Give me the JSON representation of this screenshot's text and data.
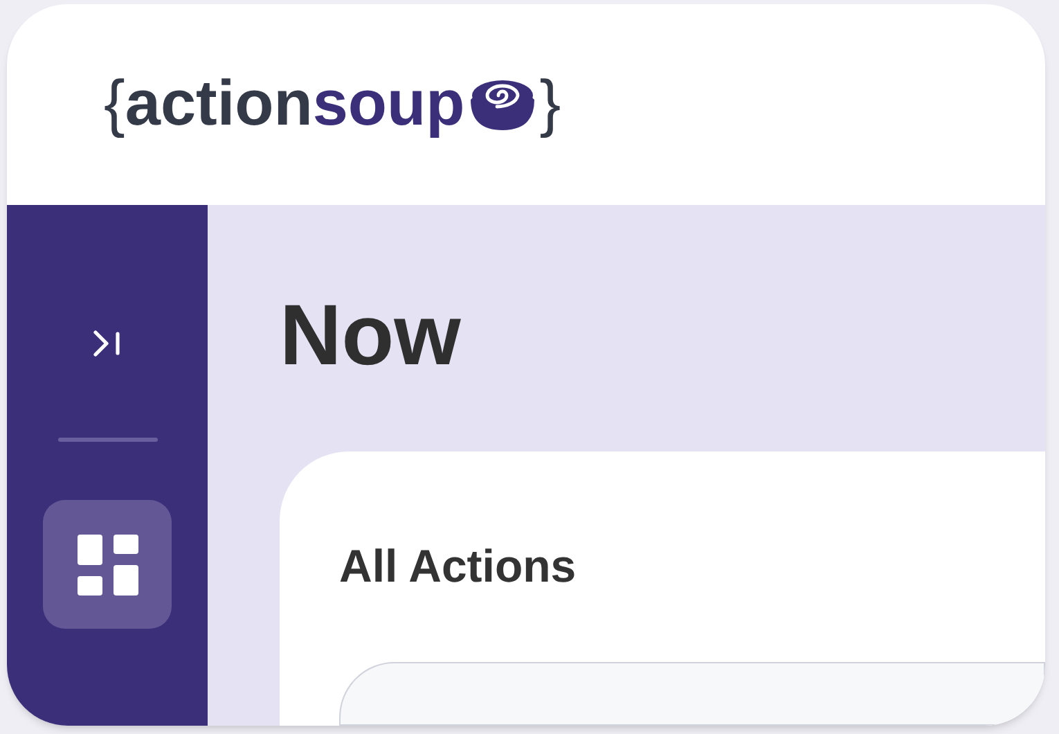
{
  "logo": {
    "open_brace": "{",
    "word_dark": "action",
    "word_accent": "soup",
    "close_brace": "}"
  },
  "sidebar": {
    "nav_items": [
      {
        "selected": true
      }
    ]
  },
  "page": {
    "title": "Now"
  },
  "card": {
    "title": "All Actions"
  }
}
